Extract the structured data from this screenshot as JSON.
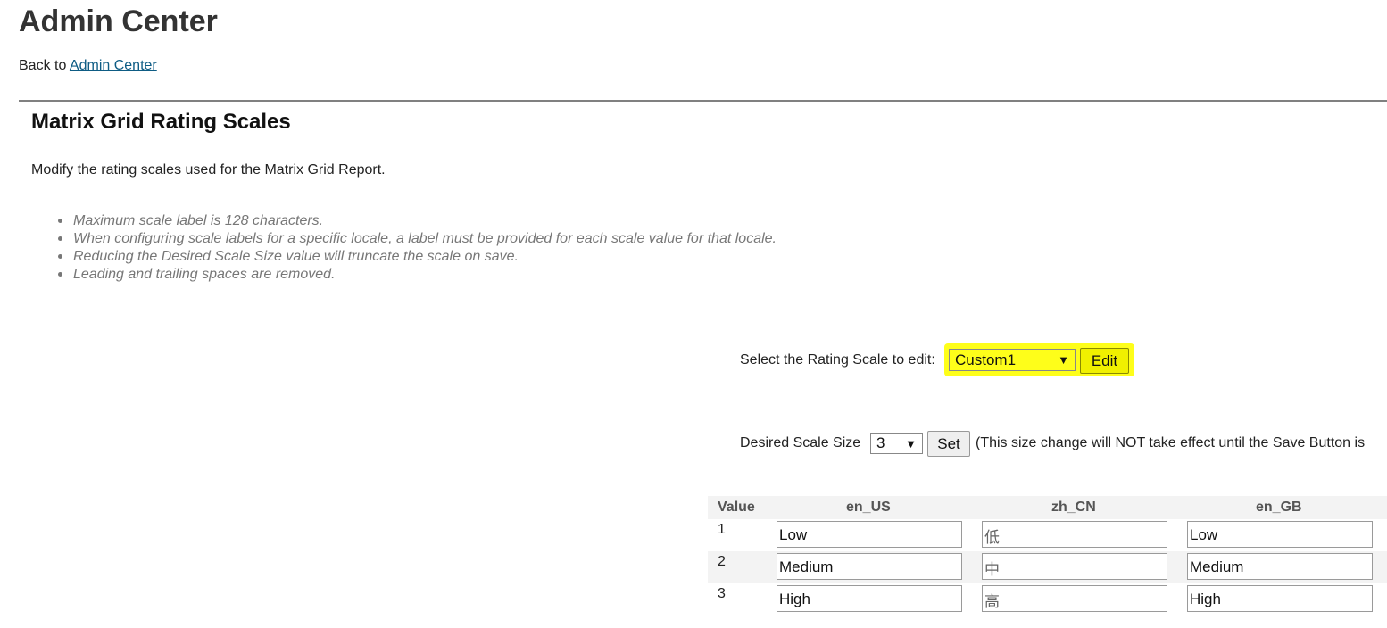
{
  "header": {
    "title": "Admin Center",
    "back_prefix": "Back to",
    "back_link": "Admin Center"
  },
  "section": {
    "title": "Matrix Grid Rating Scales",
    "description": "Modify the rating scales used for the Matrix Grid Report.",
    "notes": [
      "Maximum scale label is 128 characters.",
      "When configuring scale labels for a specific locale, a label must be provided for each scale value for that locale.",
      "Reducing the Desired Scale Size value will truncate the scale on save.",
      "Leading and trailing spaces are removed."
    ]
  },
  "scale_select": {
    "label": "Select the Rating Scale to edit:",
    "selected": "Custom1",
    "edit_button": "Edit",
    "highlight_color": "#fefe1a"
  },
  "scale_size": {
    "label": "Desired Scale Size",
    "selected": "3",
    "set_button": "Set",
    "note": "(This size change will NOT take effect until the Save Button is"
  },
  "grid": {
    "headers": [
      "Value",
      "en_US",
      "zh_CN",
      "en_GB"
    ],
    "rows": [
      {
        "value": "1",
        "en_US": "Low",
        "zh_CN": "低",
        "en_GB": "Low"
      },
      {
        "value": "2",
        "en_US": "Medium",
        "zh_CN": "中",
        "en_GB": "Medium"
      },
      {
        "value": "3",
        "en_US": "High",
        "zh_CN": "高",
        "en_GB": "High"
      }
    ]
  }
}
